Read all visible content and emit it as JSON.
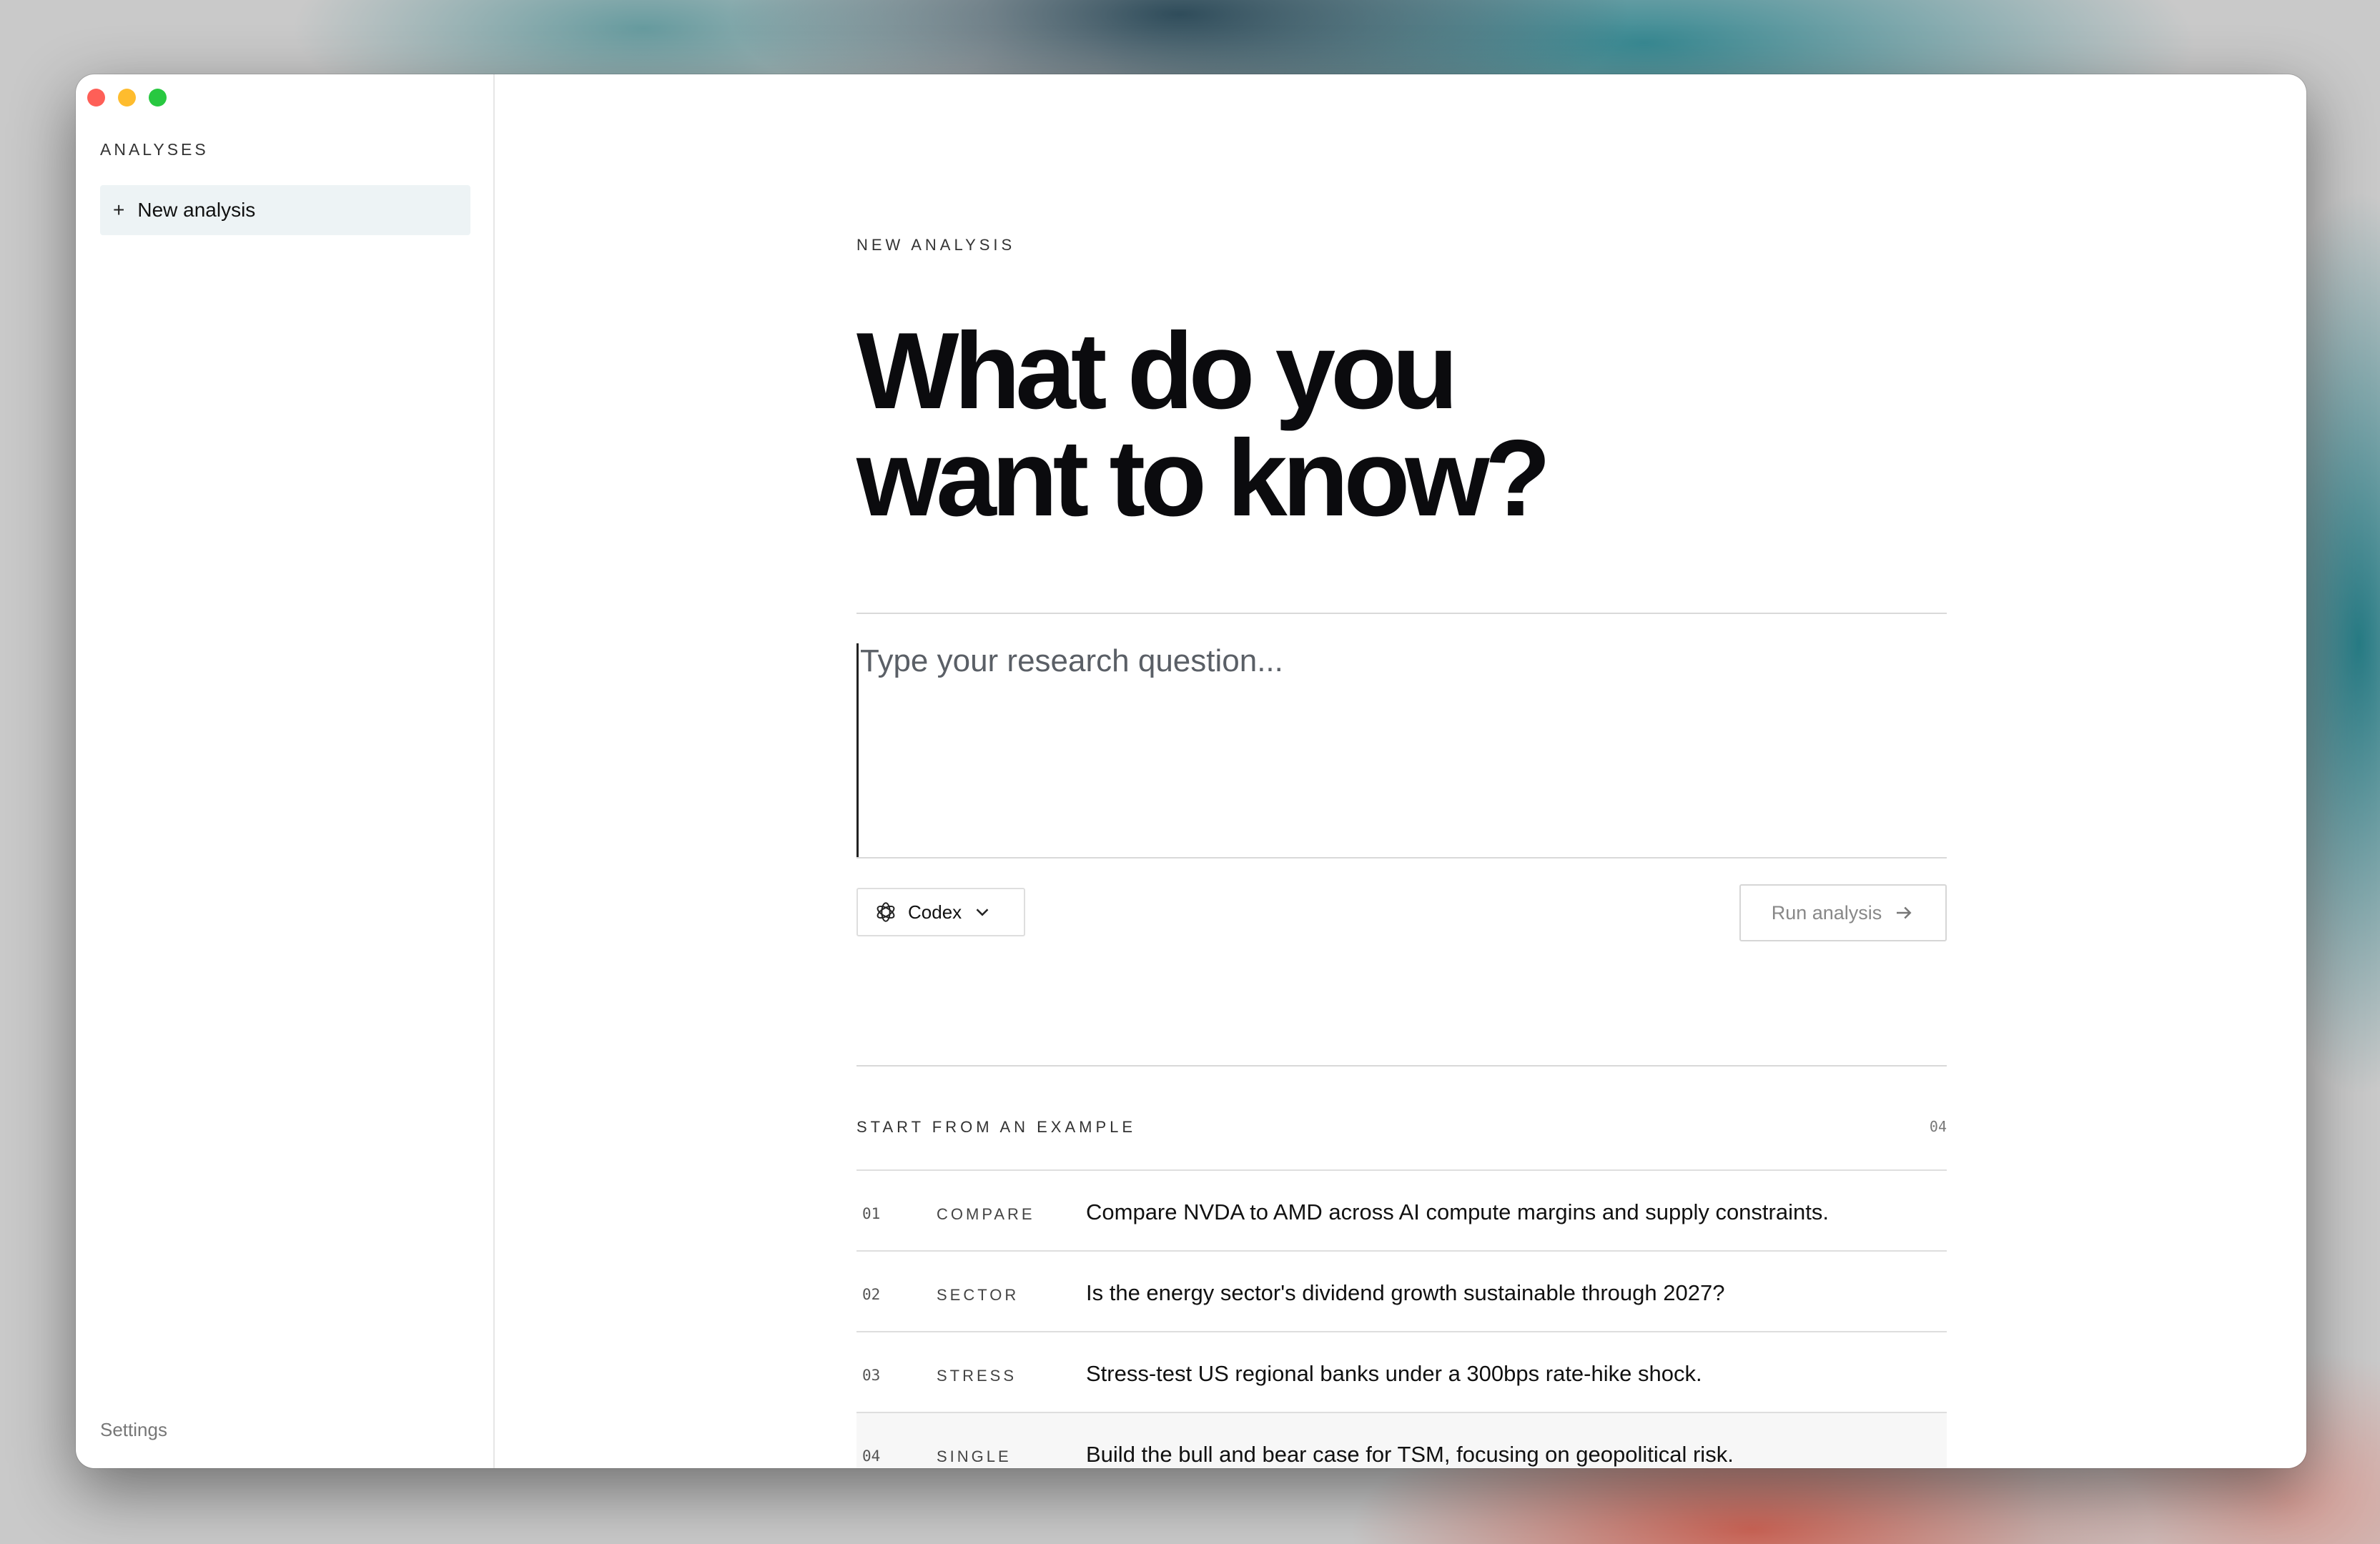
{
  "sidebar": {
    "heading": "ANALYSES",
    "new_analysis": {
      "icon": "plus-icon",
      "label": "New analysis"
    },
    "settings_label": "Settings"
  },
  "main": {
    "eyebrow": "NEW ANALYSIS",
    "headline_line1": "What do you",
    "headline_line2": "want to know?",
    "question_placeholder": "Type your research question...",
    "question_value": "",
    "model": {
      "icon": "openai-icon",
      "name": "Codex",
      "chevron": "chevron-down-icon"
    },
    "run_button": {
      "label": "Run analysis",
      "icon": "arrow-right-icon"
    },
    "examples_heading": "START FROM AN EXAMPLE",
    "examples_count": "04",
    "examples": [
      {
        "num": "01",
        "tag": "COMPARE",
        "prompt": "Compare NVDA to AMD across AI compute margins and supply constraints."
      },
      {
        "num": "02",
        "tag": "SECTOR",
        "prompt": "Is the energy sector's dividend growth sustainable through 2027?"
      },
      {
        "num": "03",
        "tag": "STRESS",
        "prompt": "Stress-test US regional banks under a 300bps rate-hike shock."
      },
      {
        "num": "04",
        "tag": "SINGLE",
        "prompt": "Build the bull and bear case for TSM, focusing on geopolitical risk."
      }
    ]
  },
  "colors": {
    "sidebar_selected_bg": "#edf3f5",
    "window_close": "#fe5f57",
    "window_minimize": "#febc2e",
    "window_zoom": "#28c840"
  }
}
